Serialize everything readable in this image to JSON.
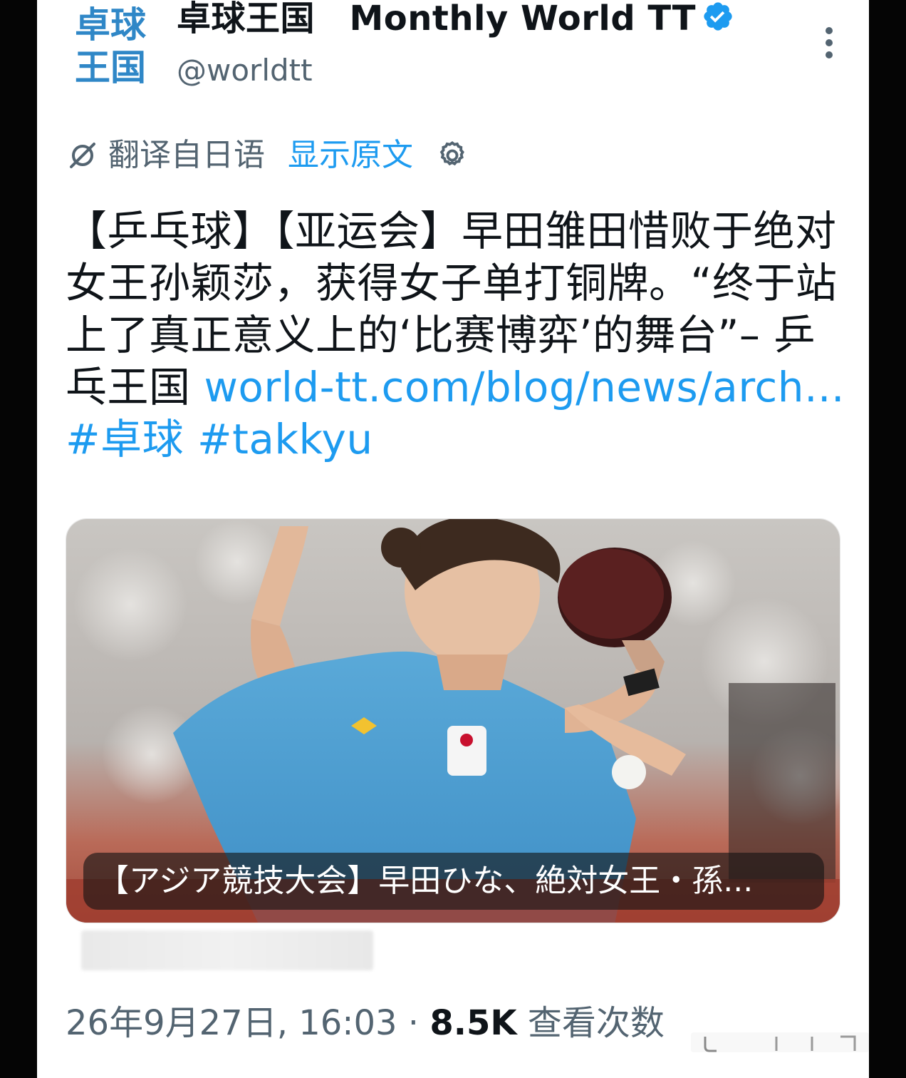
{
  "post": {
    "display_name": "卓球王国　Monthly World TT",
    "handle": "@worldtt",
    "avatar_text": [
      "卓球",
      "王国"
    ],
    "translate_label": "翻译自日语",
    "show_original_label": "显示原文",
    "text_main": "【乒乓球】【亚运会】早田雏田惜败于绝对女王孙颖莎，获得女子单打铜牌。“终于站上了真正意义上的‘比赛博弈’的舞台”– 乒乓王国 ",
    "link_text": "world-tt.com/blog/news/arch...",
    "hashtag_1": "#卓球",
    "hashtag_2": "#takkyu",
    "media_caption": "【アジア競技大会】早田ひな、絶対女王・孫...",
    "timestamp": "26年9月27日, 16:03",
    "separator": " · ",
    "views_count": "8.5K",
    "views_label": " 查看次数"
  },
  "colors": {
    "accent": "#1d9bf0",
    "text": "#0f1419",
    "secondary": "#536471",
    "avatar_brand": "#2f87c7"
  },
  "icons": {
    "verified": "verified-badge-icon",
    "more": "more-dots-icon",
    "translate": "translate-icon",
    "settings": "gear-icon"
  }
}
